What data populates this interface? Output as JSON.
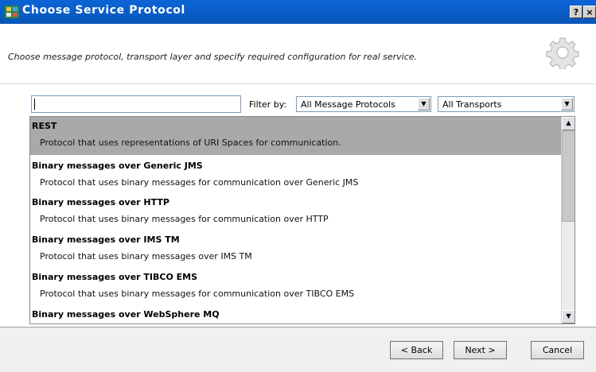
{
  "window": {
    "title": "Choose Service Protocol",
    "help_label": "?",
    "close_label": "×"
  },
  "header": {
    "description": "Choose message protocol, transport layer and specify required configuration for real service."
  },
  "filters": {
    "search_value": "",
    "filter_label": "Filter by:",
    "protocol_selected": "All Message Protocols",
    "transport_selected": "All Transports"
  },
  "protocols": [
    {
      "name": "REST",
      "description": "Protocol that uses representations of URI Spaces for communication.",
      "selected": true
    },
    {
      "name": "Binary messages over Generic JMS",
      "description": "Protocol that uses binary messages for communication over Generic JMS",
      "selected": false
    },
    {
      "name": "Binary messages over HTTP",
      "description": "Protocol that uses binary messages for communication over HTTP",
      "selected": false
    },
    {
      "name": "Binary messages over IMS TM",
      "description": "Protocol that uses binary messages over IMS TM",
      "selected": false
    },
    {
      "name": "Binary messages over TIBCO EMS",
      "description": "Protocol that uses binary messages for communication over TIBCO EMS",
      "selected": false
    },
    {
      "name": "Binary messages over WebSphere MQ",
      "description": "",
      "selected": false
    }
  ],
  "buttons": {
    "back": "< Back",
    "next": "Next >",
    "cancel": "Cancel"
  }
}
